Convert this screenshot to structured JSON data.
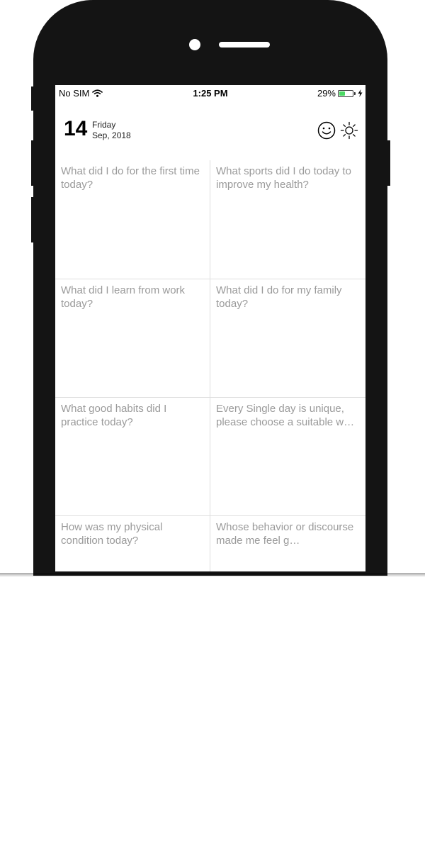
{
  "status_bar": {
    "carrier": "No SIM",
    "time": "1:25 PM",
    "battery_percent": "29%",
    "battery_level": 0.29,
    "icons": [
      "wifi-icon",
      "battery-icon",
      "charging-bolt-icon"
    ]
  },
  "header": {
    "day": "14",
    "weekday": "Friday",
    "month_year": "Sep, 2018",
    "actions": [
      "smiley-face-icon",
      "sun-icon"
    ]
  },
  "prompts": [
    "What did I do for the first time  today?",
    "What sports did I do today to improve my health?",
    "What did I learn from work today?",
    "What did I do for my family today?",
    "What good habits did I practice today?",
    "Every Single day is unique, please choose a suitable w…",
    "How was my physical condition today?",
    "Whose behavior or discourse made me feel g…"
  ],
  "colors": {
    "phone_body": "#141414",
    "prompt_text": "#9a9a9a",
    "grid_lines": "#dedede",
    "battery_fill": "#4cd964"
  }
}
